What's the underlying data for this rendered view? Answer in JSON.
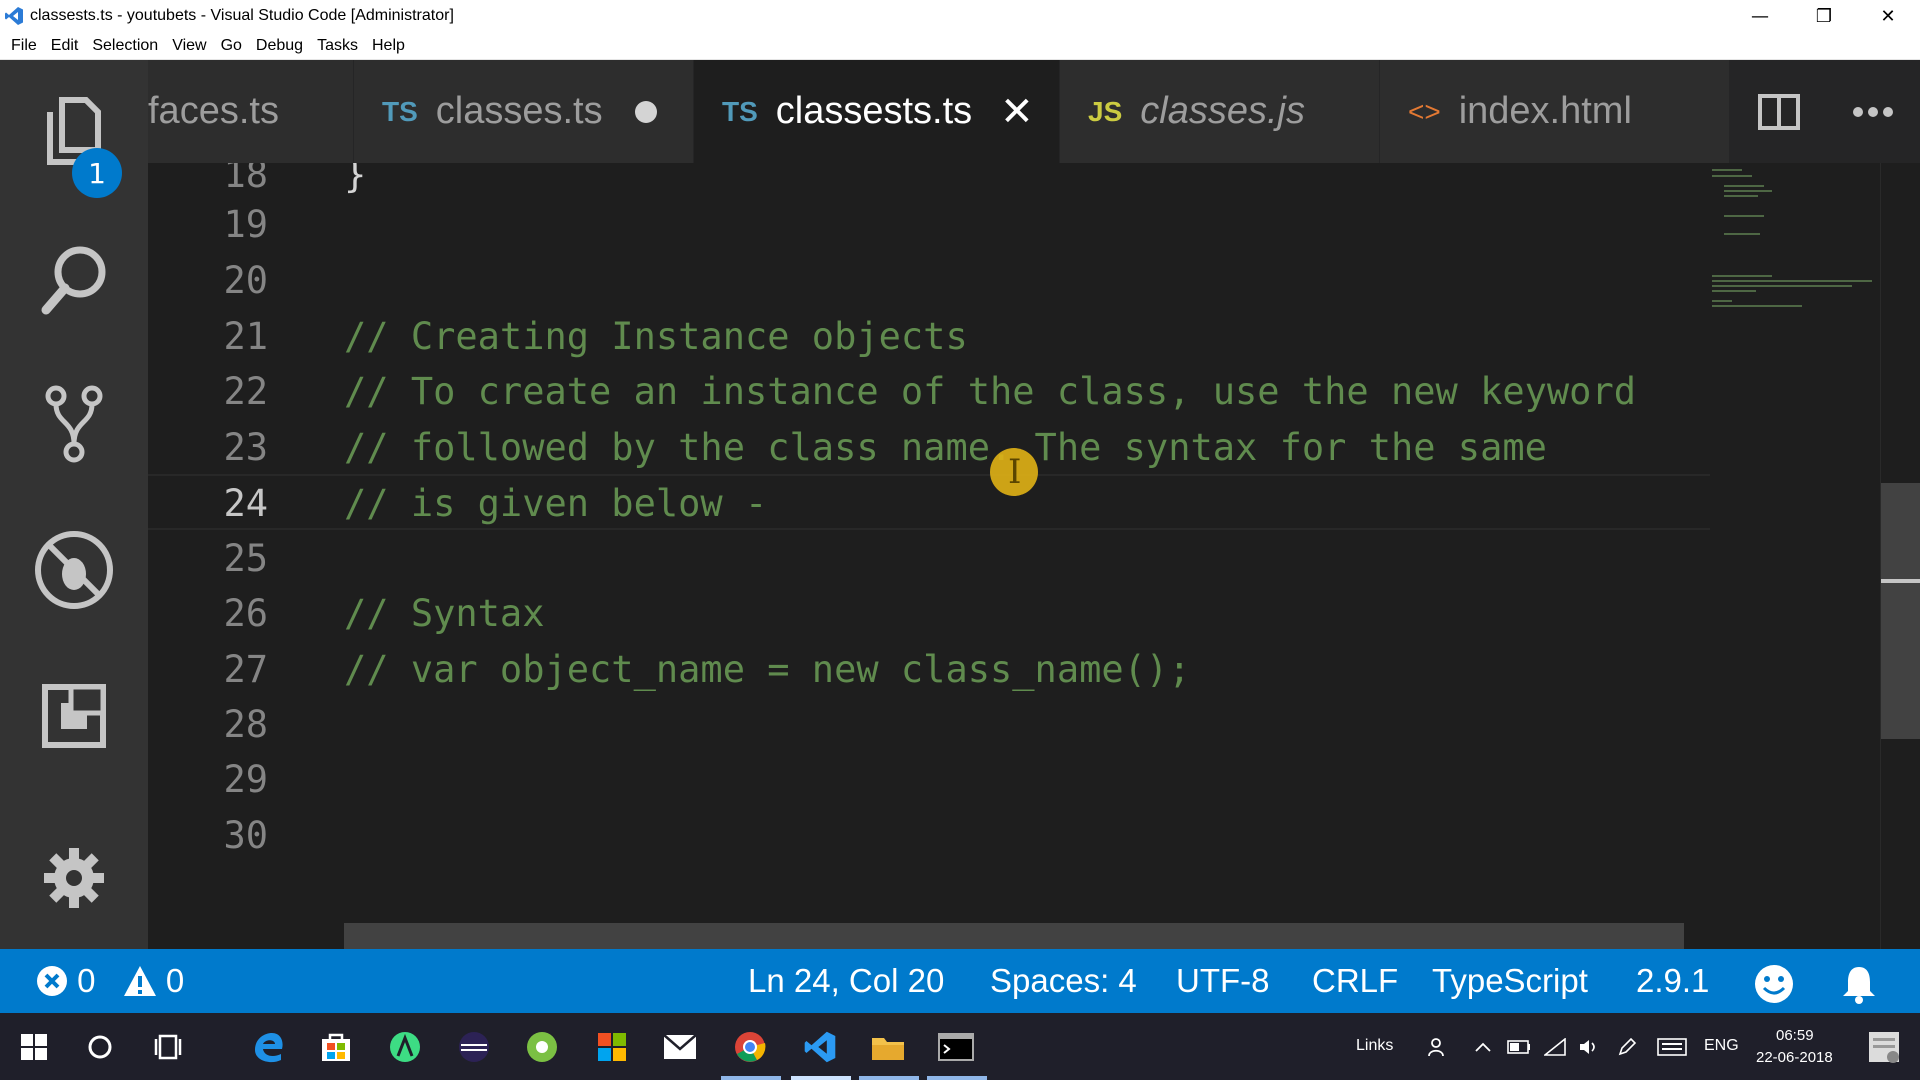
{
  "window": {
    "title": "classests.ts - youtubets - Visual Studio Code [Administrator]",
    "controls": [
      "—",
      "❐",
      "✕"
    ]
  },
  "menu": [
    "File",
    "Edit",
    "Selection",
    "View",
    "Go",
    "Debug",
    "Tasks",
    "Help"
  ],
  "activity_bar": {
    "explorer_badge": "1",
    "icons": [
      "files-icon",
      "search-icon",
      "source-control-icon",
      "debug-icon",
      "extensions-icon",
      "settings-gear-icon"
    ]
  },
  "tabs": [
    {
      "lang": "",
      "label": "faces.ts",
      "state": "normal"
    },
    {
      "lang": "TS",
      "label": "classes.ts",
      "state": "dirty"
    },
    {
      "lang": "TS",
      "label": "classests.ts",
      "state": "active"
    },
    {
      "lang": "JS",
      "label": "classes.js",
      "state": "preview"
    },
    {
      "lang": "<>",
      "label": "index.html",
      "state": "normal"
    }
  ],
  "editor": {
    "current_line": "24",
    "lines": [
      {
        "num": "18",
        "text": "}",
        "kind": "plain"
      },
      {
        "num": "19",
        "text": "",
        "kind": "plain"
      },
      {
        "num": "20",
        "text": "",
        "kind": "plain"
      },
      {
        "num": "21",
        "text": "// Creating Instance objects",
        "kind": "comment"
      },
      {
        "num": "22",
        "text": "// To create an instance of the class, use the new keyword",
        "kind": "comment"
      },
      {
        "num": "23",
        "text": "// followed by the class name. The syntax for the same",
        "kind": "comment"
      },
      {
        "num": "24",
        "text": "// is given below -",
        "kind": "comment"
      },
      {
        "num": "25",
        "text": "",
        "kind": "plain"
      },
      {
        "num": "26",
        "text": "// Syntax",
        "kind": "comment"
      },
      {
        "num": "27",
        "text": "// var object_name = new class_name();",
        "kind": "comment"
      },
      {
        "num": "28",
        "text": "",
        "kind": "plain"
      },
      {
        "num": "29",
        "text": "",
        "kind": "plain"
      },
      {
        "num": "30",
        "text": "",
        "kind": "plain"
      }
    ]
  },
  "statusbar": {
    "errors": "0",
    "warnings": "0",
    "position": "Ln 24, Col 20",
    "spaces": "Spaces: 4",
    "encoding": "UTF-8",
    "eol": "CRLF",
    "language": "TypeScript",
    "version": "2.9.1"
  },
  "taskbar": {
    "links": "Links",
    "lang": "ENG",
    "time": "06:59",
    "date": "22-06-2018"
  },
  "colors": {
    "accent": "#007acc",
    "comment": "#608b4e",
    "editor_bg": "#1e1e1e"
  }
}
